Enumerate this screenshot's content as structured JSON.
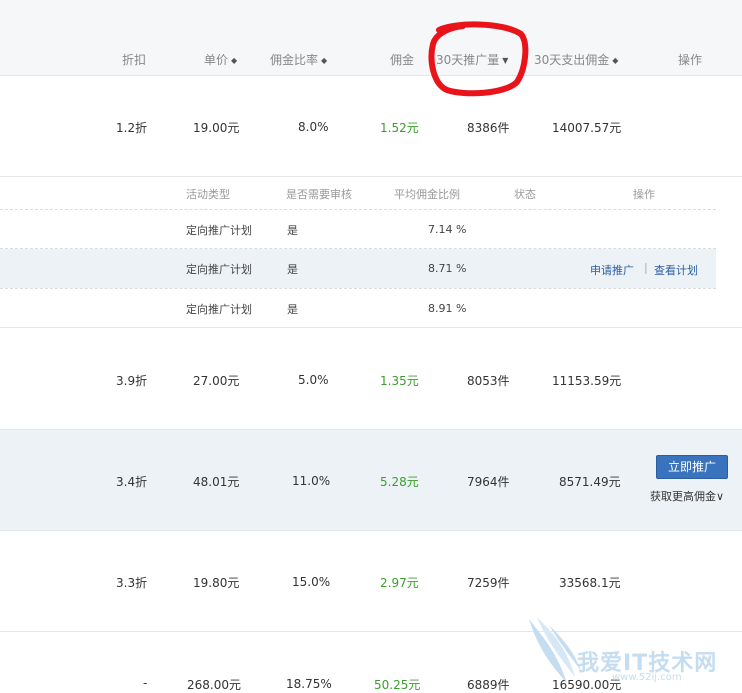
{
  "headers": {
    "discount": "折扣",
    "unit_price": "单价",
    "commission_rate": "佣金比率",
    "commission": "佣金",
    "sales_30d": "30天推广量",
    "paid_30d": "30天支出佣金",
    "actions": "操作"
  },
  "sort_icon": "◆",
  "sort_desc_icon": "▼",
  "rows": [
    {
      "discount": "1.2折",
      "price": "19.00元",
      "rate": "8.0%",
      "commission": "1.52元",
      "sales": "8386件",
      "paid": "14007.57元"
    },
    {
      "discount": "3.9折",
      "price": "27.00元",
      "rate": "5.0%",
      "commission": "1.35元",
      "sales": "8053件",
      "paid": "11153.59元"
    },
    {
      "discount": "3.4折",
      "price": "48.01元",
      "rate": "11.0%",
      "commission": "5.28元",
      "sales": "7964件",
      "paid": "8571.49元"
    },
    {
      "discount": "3.3折",
      "price": "19.80元",
      "rate": "15.0%",
      "commission": "2.97元",
      "sales": "7259件",
      "paid": "33568.1元"
    },
    {
      "discount": "-",
      "price": "268.00元",
      "rate": "18.75%",
      "commission": "50.25元",
      "sales": "6889件",
      "paid": "16590.00元"
    }
  ],
  "plans": {
    "headers": {
      "type": "活动类型",
      "review": "是否需要审核",
      "avg_rate": "平均佣金比例",
      "status": "状态",
      "actions": "操作"
    },
    "items": [
      {
        "type": "定向推广计划",
        "review": "是",
        "avg": "7.14 %"
      },
      {
        "type": "定向推广计划",
        "review": "是",
        "avg": "8.71 %"
      },
      {
        "type": "定向推广计划",
        "review": "是",
        "avg": "8.91 %"
      }
    ],
    "apply_link": "申请推广",
    "view_link": "查看计划",
    "separator": "|"
  },
  "promote_button": "立即推广",
  "higher_commission": "获取更高佣金∨",
  "watermark": {
    "text": "我爱IT技术网",
    "sub": "www.52ij.com"
  },
  "colors": {
    "commission_green": "#3b9e2c",
    "button_blue": "#3a73bd",
    "link_blue": "#2a5ea8",
    "highlight_bg": "#edf2f7",
    "annotation_red": "#e8141a"
  }
}
